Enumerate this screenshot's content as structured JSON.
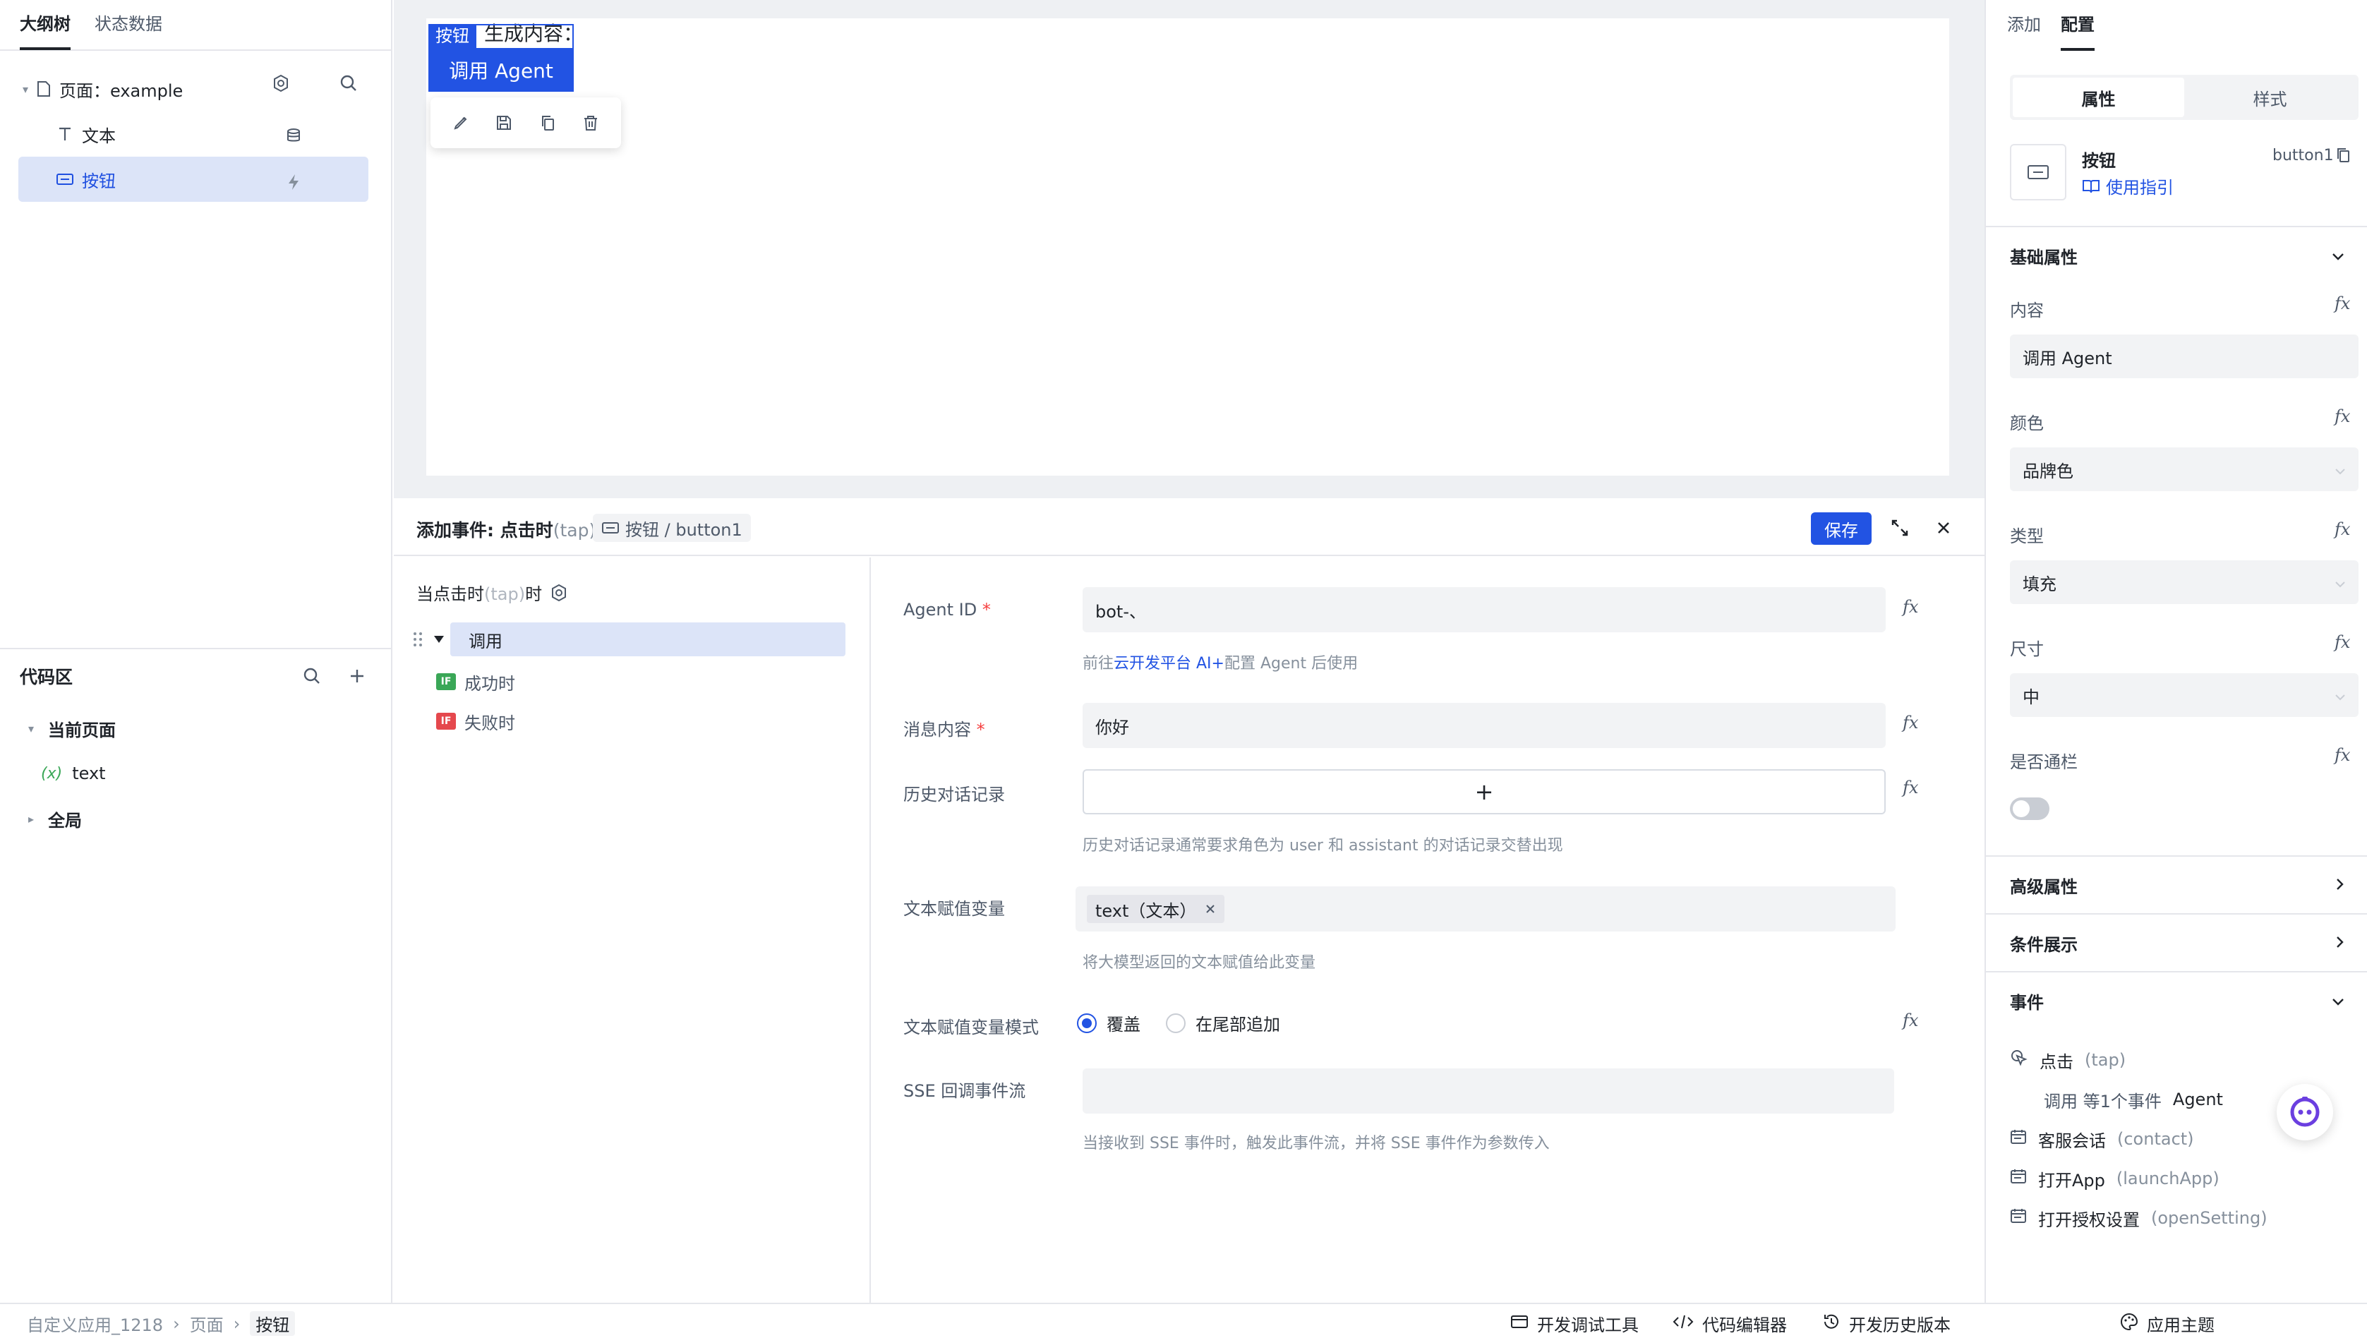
{
  "left": {
    "tabs": [
      "大纲树",
      "状态数据"
    ],
    "tree": {
      "page_label": "页面：example",
      "text_label": "文本",
      "button_label": "按钮"
    },
    "code": {
      "title": "代码区",
      "current_page": "当前页面",
      "var_prefix": "(x)",
      "var_name": "text",
      "global": "全局"
    }
  },
  "canvas": {
    "gen_text": "生成内容：",
    "tag": "按钮",
    "button_text": "调用 Agent"
  },
  "event_editor": {
    "title": "添加事件: 点击时",
    "title_suffix": "(tap)",
    "chip": "按钮 / button1",
    "save": "保存",
    "flow": {
      "trigger": "当点击时",
      "trigger_muted": "(tap)",
      "trigger_suffix": "时",
      "node": "调用",
      "success": "成功时",
      "failure": "失败时",
      "if": "IF"
    },
    "form": {
      "agent_id_label": "Agent ID",
      "required": "*",
      "agent_id_value": "bot-、",
      "agent_hint_pre": "前往",
      "agent_hint_link": "云开发平台 AI+",
      "agent_hint_post": "配置 Agent 后使用",
      "msg_label": "消息内容",
      "msg_value": "你好",
      "history_label": "历史对话记录",
      "history_add": "+",
      "history_hint": "历史对话记录通常要求角色为 user 和 assistant 的对话记录交替出现",
      "assign_label": "文本赋值变量",
      "assign_chip": "text（文本）",
      "assign_hint": "将大模型返回的文本赋值给此变量",
      "mode_label": "文本赋值变量模式",
      "mode_overwrite": "覆盖",
      "mode_append": "在尾部追加",
      "sse_label": "SSE 回调事件流",
      "sse_hint": "当接收到 SSE 事件时，触发此事件流，并将 SSE 事件作为参数传入",
      "fx": "fx"
    }
  },
  "right": {
    "tabs": [
      "添加",
      "配置"
    ],
    "seg": [
      "属性",
      "样式"
    ],
    "comp_name": "按钮",
    "comp_id": "button1",
    "guide": "使用指引",
    "basic_title": "基础属性",
    "content_label": "内容",
    "content_value": "调用 Agent",
    "color_label": "颜色",
    "color_value": "品牌色",
    "type_label": "类型",
    "type_value": "填充",
    "size_label": "尺寸",
    "size_value": "中",
    "full_label": "是否通栏",
    "full_value": false,
    "advanced_title": "高级属性",
    "cond_title": "条件展示",
    "events_title": "事件",
    "events": [
      {
        "name": "点击",
        "code": "(tap)"
      },
      {
        "name": "调用 等1个事件",
        "code": "Agent"
      },
      {
        "name": "客服会话",
        "code": "(contact)"
      },
      {
        "name": "打开App",
        "code": "(launchApp)"
      },
      {
        "name": "打开授权设置",
        "code": "(openSetting)"
      }
    ],
    "fx": "fx"
  },
  "bottom": {
    "crumbs": [
      "自定义应用_1218",
      "页面",
      "按钮"
    ],
    "dev_tools": "开发调试工具",
    "code_editor": "代码编辑器",
    "history": "开发历史版本",
    "theme": "应用主题"
  },
  "colors": {
    "brand": "#2253e3",
    "selected_bg": "#dce4f8",
    "if_success": "#3aa757",
    "if_failure": "#e5484d"
  }
}
